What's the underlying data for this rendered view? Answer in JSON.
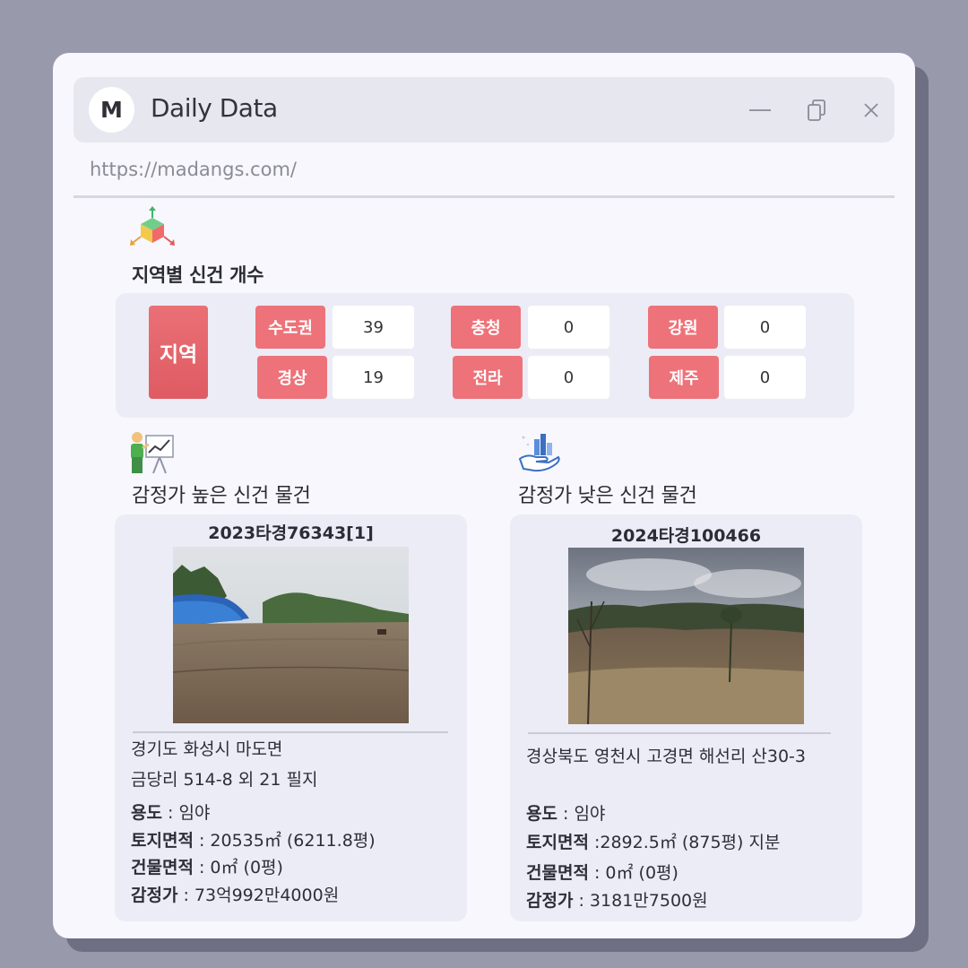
{
  "app": {
    "avatar_letter": "M",
    "title": "Daily Data",
    "url": "https://madangs.com/"
  },
  "region_section": {
    "title": "지역별 신건 개수",
    "main_label": "지역",
    "regions": [
      {
        "name": "수도권",
        "count": "39"
      },
      {
        "name": "경상",
        "count": "19"
      },
      {
        "name": "충청",
        "count": "0"
      },
      {
        "name": "전라",
        "count": "0"
      },
      {
        "name": "강원",
        "count": "0"
      },
      {
        "name": "제주",
        "count": "0"
      }
    ]
  },
  "high_section": {
    "title": "감정가 높은 신건 물건",
    "case_no": "2023타경76343[1]",
    "address_line1": "경기도 화성시 마도면",
    "address_line2": "금당리 514-8 외 21 필지",
    "use_label": "용도",
    "use_value": " : 임야",
    "land_label": "토지면적",
    "land_value": " : 20535㎡ (6211.8평)",
    "building_label": "건물면적",
    "building_value": " : 0㎡ (0평)",
    "appraisal_label": "감정가",
    "appraisal_value": " : 73억992만4000원"
  },
  "low_section": {
    "title": "감정가 낮은 신건 물건",
    "case_no": "2024타경100466",
    "address_line1": "경상북도 영천시 고경면 해선리 산30-3",
    "use_label": "용도",
    "use_value": " : 임야",
    "land_label": "토지면적",
    "land_value": " :2892.5㎡ (875평) 지분",
    "building_label": "건물면적",
    "building_value": " : 0㎡ (0평)",
    "appraisal_label": "감정가",
    "appraisal_value": " : 3181만7500원"
  },
  "icons": {
    "minimize": "minimize-icon",
    "restore": "restore-icon",
    "close": "close-icon",
    "region": "cube-arrows-icon",
    "high": "presentation-chart-icon",
    "low": "hand-bar-chart-icon"
  },
  "colors": {
    "background": "#9899ab",
    "window": "#f7f7fd",
    "accent": "#ee7279",
    "panel": "#ececf6"
  }
}
